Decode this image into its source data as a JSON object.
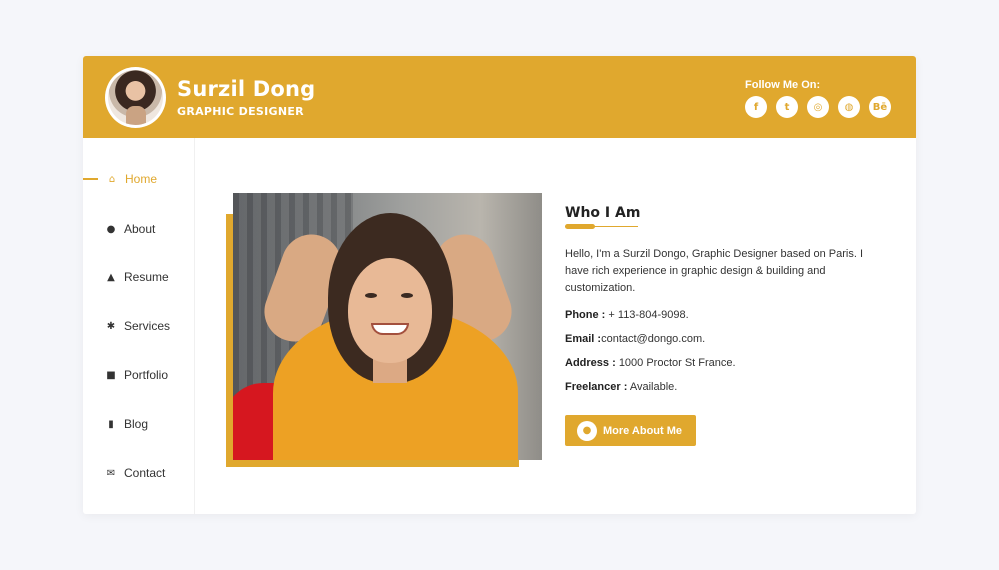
{
  "header": {
    "name": "Surzil Dong",
    "role": "GRAPHIC DESIGNER",
    "follow_label": "Follow Me On:",
    "socials": [
      {
        "name": "facebook-icon",
        "glyph": "f"
      },
      {
        "name": "twitter-icon",
        "glyph": "t"
      },
      {
        "name": "instagram-icon",
        "glyph": "◎"
      },
      {
        "name": "dribbble-icon",
        "glyph": "◍"
      },
      {
        "name": "behance-icon",
        "glyph": "Bē"
      }
    ]
  },
  "sidebar": {
    "items": [
      {
        "label": "Home",
        "icon": "home-icon",
        "glyph": "⌂",
        "active": true
      },
      {
        "label": "About",
        "icon": "user-icon",
        "glyph": "●"
      },
      {
        "label": "Resume",
        "icon": "graduation-cap-icon",
        "glyph": "▲"
      },
      {
        "label": "Services",
        "icon": "cogs-icon",
        "glyph": "✱"
      },
      {
        "label": "Portfolio",
        "icon": "briefcase-icon",
        "glyph": "■"
      },
      {
        "label": "Blog",
        "icon": "book-icon",
        "glyph": "▮"
      },
      {
        "label": "Contact",
        "icon": "envelope-icon",
        "glyph": "✉"
      }
    ]
  },
  "about": {
    "title": "Who I Am",
    "bio": "Hello, I'm a Surzil Dongo, Graphic Designer based on Paris. I have rich experience in graphic design & building and customization.",
    "phone_label": "Phone :",
    "phone": "+ 113-804-9098.",
    "email_label": "Email :",
    "email": "contact@dongo.com.",
    "address_label": "Address :",
    "address": "1000 Proctor St France.",
    "freelancer_label": "Freelancer :",
    "freelancer": "Available.",
    "button_label": "More About Me"
  },
  "colors": {
    "accent": "#e0a82e",
    "background": "#f5f6fa"
  }
}
